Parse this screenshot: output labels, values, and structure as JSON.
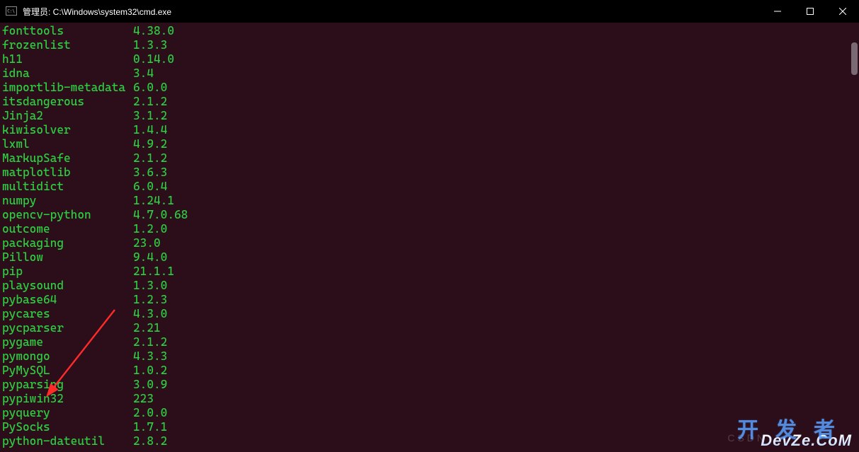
{
  "window": {
    "title": "管理员: C:\\Windows\\system32\\cmd.exe"
  },
  "packages": [
    {
      "name": "fonttools",
      "version": "4.38.0"
    },
    {
      "name": "frozenlist",
      "version": "1.3.3"
    },
    {
      "name": "h11",
      "version": "0.14.0"
    },
    {
      "name": "idna",
      "version": "3.4"
    },
    {
      "name": "importlib-metadata",
      "version": "6.0.0"
    },
    {
      "name": "itsdangerous",
      "version": "2.1.2"
    },
    {
      "name": "Jinja2",
      "version": "3.1.2"
    },
    {
      "name": "kiwisolver",
      "version": "1.4.4"
    },
    {
      "name": "lxml",
      "version": "4.9.2"
    },
    {
      "name": "MarkupSafe",
      "version": "2.1.2"
    },
    {
      "name": "matplotlib",
      "version": "3.6.3"
    },
    {
      "name": "multidict",
      "version": "6.0.4"
    },
    {
      "name": "numpy",
      "version": "1.24.1"
    },
    {
      "name": "opencv-python",
      "version": "4.7.0.68"
    },
    {
      "name": "outcome",
      "version": "1.2.0"
    },
    {
      "name": "packaging",
      "version": "23.0"
    },
    {
      "name": "Pillow",
      "version": "9.4.0"
    },
    {
      "name": "pip",
      "version": "21.1.1"
    },
    {
      "name": "playsound",
      "version": "1.3.0"
    },
    {
      "name": "pybase64",
      "version": "1.2.3"
    },
    {
      "name": "pycares",
      "version": "4.3.0"
    },
    {
      "name": "pycparser",
      "version": "2.21"
    },
    {
      "name": "pygame",
      "version": "2.1.2"
    },
    {
      "name": "pymongo",
      "version": "4.3.3"
    },
    {
      "name": "PyMySQL",
      "version": "1.0.2"
    },
    {
      "name": "pyparsing",
      "version": "3.0.9"
    },
    {
      "name": "pypiwin32",
      "version": "223"
    },
    {
      "name": "pyquery",
      "version": "2.0.0"
    },
    {
      "name": "PySocks",
      "version": "1.7.1"
    },
    {
      "name": "python-dateutil",
      "version": "2.8.2"
    }
  ],
  "watermark": {
    "zh": "开发者",
    "en": "DevZe.CoM",
    "csdn": "CSDN"
  }
}
